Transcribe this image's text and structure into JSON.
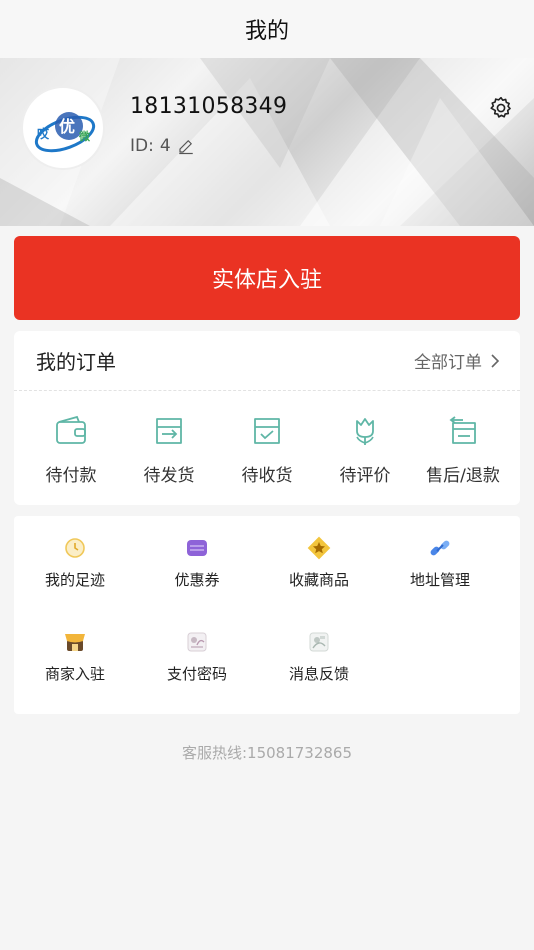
{
  "navbar": {
    "title": "我的"
  },
  "profile": {
    "phone": "18131058349",
    "id_label": "ID:",
    "id_value": "4",
    "avatar_logo_text": [
      "哎",
      "优",
      "微"
    ]
  },
  "store_button": {
    "label": "实体店入驻"
  },
  "orders": {
    "title": "我的订单",
    "all_label": "全部订单",
    "items": [
      {
        "label": "待付款",
        "icon": "wallet-icon"
      },
      {
        "label": "待发货",
        "icon": "box-send-icon"
      },
      {
        "label": "待收货",
        "icon": "box-receive-icon"
      },
      {
        "label": "待评价",
        "icon": "flower-icon"
      },
      {
        "label": "售后/退款",
        "icon": "refund-icon"
      }
    ]
  },
  "tools": {
    "items": [
      {
        "label": "我的足迹",
        "icon": "clock-icon"
      },
      {
        "label": "优惠券",
        "icon": "coupon-icon"
      },
      {
        "label": "收藏商品",
        "icon": "star-icon"
      },
      {
        "label": "地址管理",
        "icon": "link-icon"
      },
      {
        "label": "商家入驻",
        "icon": "shop-icon"
      },
      {
        "label": "支付密码",
        "icon": "password-icon"
      },
      {
        "label": "消息反馈",
        "icon": "feedback-icon"
      }
    ]
  },
  "hotline": {
    "text": "客服热线:15081732865"
  },
  "colors": {
    "accent": "#ea3323",
    "icon_teal": "#5fb6a6",
    "background": "#f5f5f5"
  }
}
